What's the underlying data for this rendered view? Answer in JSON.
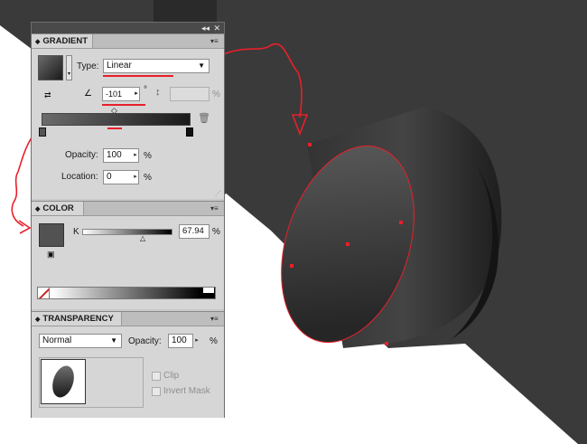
{
  "panel_header": {
    "collapse_icon": "double-chevron-icon",
    "close_icon": "close-icon"
  },
  "gradient": {
    "tab_label": "GRADIENT",
    "type_label": "Type:",
    "type_value": "Linear",
    "angle_value": "-101",
    "angle_unit": "°",
    "aspect_unit": "%",
    "opacity_label": "Opacity:",
    "opacity_value": "100",
    "opacity_unit": "%",
    "location_label": "Location:",
    "location_value": "0",
    "location_unit": "%"
  },
  "color": {
    "tab_label": "COLOR",
    "channel_label": "K",
    "value": "67.94",
    "unit": "%",
    "k_level": 0.6794
  },
  "transparency": {
    "tab_label": "TRANSPARENCY",
    "blend_mode": "Normal",
    "opacity_label": "Opacity:",
    "opacity_value": "100",
    "opacity_unit": "%",
    "clip_label": "Clip",
    "invert_mask_label": "Invert Mask"
  },
  "colors": {
    "annotation_red": "#e8202a",
    "artboard_dark": "#3a3a3a",
    "cylinder_face_light": "#5a5a5a",
    "cylinder_face_dark": "#2b2b2b"
  }
}
